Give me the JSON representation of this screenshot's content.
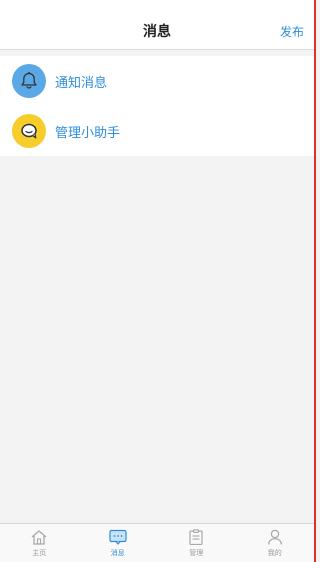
{
  "header": {
    "title": "消息",
    "publish_label": "发布"
  },
  "messages": [
    {
      "label": "通知消息",
      "icon": "bell-icon",
      "color": "#5aa8e6"
    },
    {
      "label": "管理小助手",
      "icon": "chat-bubble-icon",
      "color": "#f6cd2b"
    }
  ],
  "tabs": [
    {
      "label": "主页",
      "icon": "home-icon",
      "active": false
    },
    {
      "label": "消息",
      "icon": "message-icon",
      "active": true
    },
    {
      "label": "管理",
      "icon": "clipboard-icon",
      "active": false
    },
    {
      "label": "我的",
      "icon": "user-icon",
      "active": false
    }
  ],
  "colors": {
    "accent": "#2f8ed8",
    "background": "#f3f3f3",
    "edge": "#e0302c"
  }
}
